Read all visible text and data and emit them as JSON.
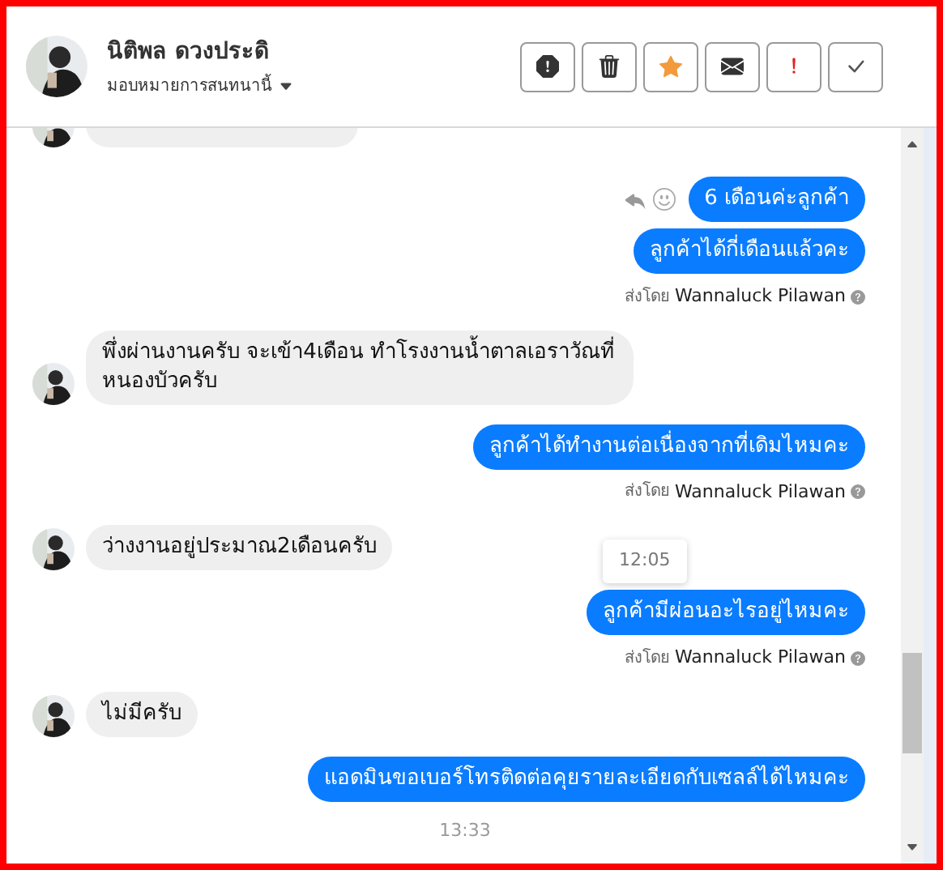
{
  "contact": {
    "name": "นิติพล ดวงประดิ",
    "assign_label": "มอบหมายการสนทนานี้"
  },
  "messages": [
    {
      "kind": "incoming",
      "cut": true
    },
    {
      "kind": "outgoing",
      "text": "6 เดือนค่ะลูกค้า",
      "hover_actions": true
    },
    {
      "kind": "outgoing",
      "text": "ลูกค้าได้กี่เดือนแล้วคะ"
    },
    {
      "kind": "sender",
      "label": "ส่งโดย",
      "name": "Wannaluck Pilawan"
    },
    {
      "kind": "incoming",
      "text": "พึ่งผ่านงานครับ จะเข้า4เดือน ทำโรงงานน้ำตาลเอราวัณที่หนองบัวครับ"
    },
    {
      "kind": "outgoing",
      "text": "ลูกค้าได้ทำงานต่อเนื่องจากที่เดิมไหมคะ"
    },
    {
      "kind": "sender",
      "label": "ส่งโดย",
      "name": "Wannaluck Pilawan"
    },
    {
      "kind": "incoming",
      "text": "ว่างงานอยู่ประมาณ2เดือนครับ",
      "tooltip": "12:05"
    },
    {
      "kind": "outgoing",
      "text": "ลูกค้ามีผ่อนอะไรอยู่ไหมคะ"
    },
    {
      "kind": "sender",
      "label": "ส่งโดย",
      "name": "Wannaluck Pilawan"
    },
    {
      "kind": "incoming",
      "text": "ไม่มีครับ"
    },
    {
      "kind": "outgoing",
      "text": "แอดมินขอเบอร์โทรติดต่อคุยรายละเอียดกับเซลล์ได้ไหมคะ"
    },
    {
      "kind": "time",
      "text": "13:33"
    }
  ]
}
